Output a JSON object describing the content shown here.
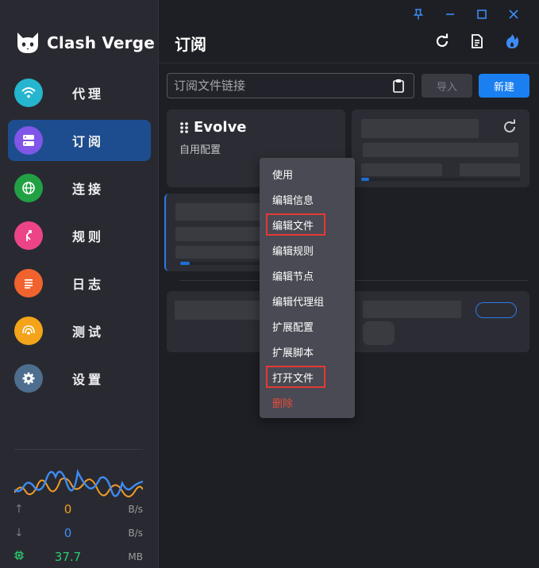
{
  "app": {
    "name": "Clash Verge"
  },
  "window_controls": [
    "pin-icon",
    "minimize-icon",
    "maximize-icon",
    "close-icon"
  ],
  "sidebar": {
    "items": [
      {
        "label": "代理",
        "icon": "wifi-icon",
        "color": "#26b5cf"
      },
      {
        "label": "订阅",
        "icon": "server-icon",
        "color": "#7f56e8",
        "active": true
      },
      {
        "label": "连接",
        "icon": "globe-icon",
        "color": "#21a144"
      },
      {
        "label": "规则",
        "icon": "route-icon",
        "color": "#ec4487"
      },
      {
        "label": "日志",
        "icon": "list-icon",
        "color": "#f0632e"
      },
      {
        "label": "测试",
        "icon": "radar-icon",
        "color": "#f3a41a"
      },
      {
        "label": "设置",
        "icon": "gear-icon",
        "color": "#4d6e8e"
      }
    ],
    "traffic": {
      "upload": {
        "value": "0",
        "unit": "B/s",
        "color": "#f39c28"
      },
      "download": {
        "value": "0",
        "unit": "B/s",
        "color": "#3c8cf5"
      },
      "memory": {
        "value": "37.7",
        "unit": "MB",
        "color": "#2ecc71"
      }
    }
  },
  "header": {
    "title": "订阅",
    "actions": [
      "refresh-icon",
      "document-icon",
      "fire-icon"
    ]
  },
  "toolbar": {
    "url_placeholder": "订阅文件链接",
    "import_label": "导入",
    "new_label": "新建"
  },
  "profiles": [
    {
      "name": "Evolve",
      "type": "自用配置"
    }
  ],
  "context_menu": {
    "items": [
      {
        "label": "使用"
      },
      {
        "label": "编辑信息"
      },
      {
        "label": "编辑文件",
        "highlighted": true
      },
      {
        "label": "编辑规则"
      },
      {
        "label": "编辑节点"
      },
      {
        "label": "编辑代理组"
      },
      {
        "label": "扩展配置"
      },
      {
        "label": "扩展脚本"
      },
      {
        "label": "打开文件",
        "highlighted": true
      },
      {
        "label": "删除",
        "danger": true
      }
    ]
  },
  "colors": {
    "accent": "#1a7ff0",
    "highlight": "#e53935",
    "danger": "#e74c3c"
  }
}
